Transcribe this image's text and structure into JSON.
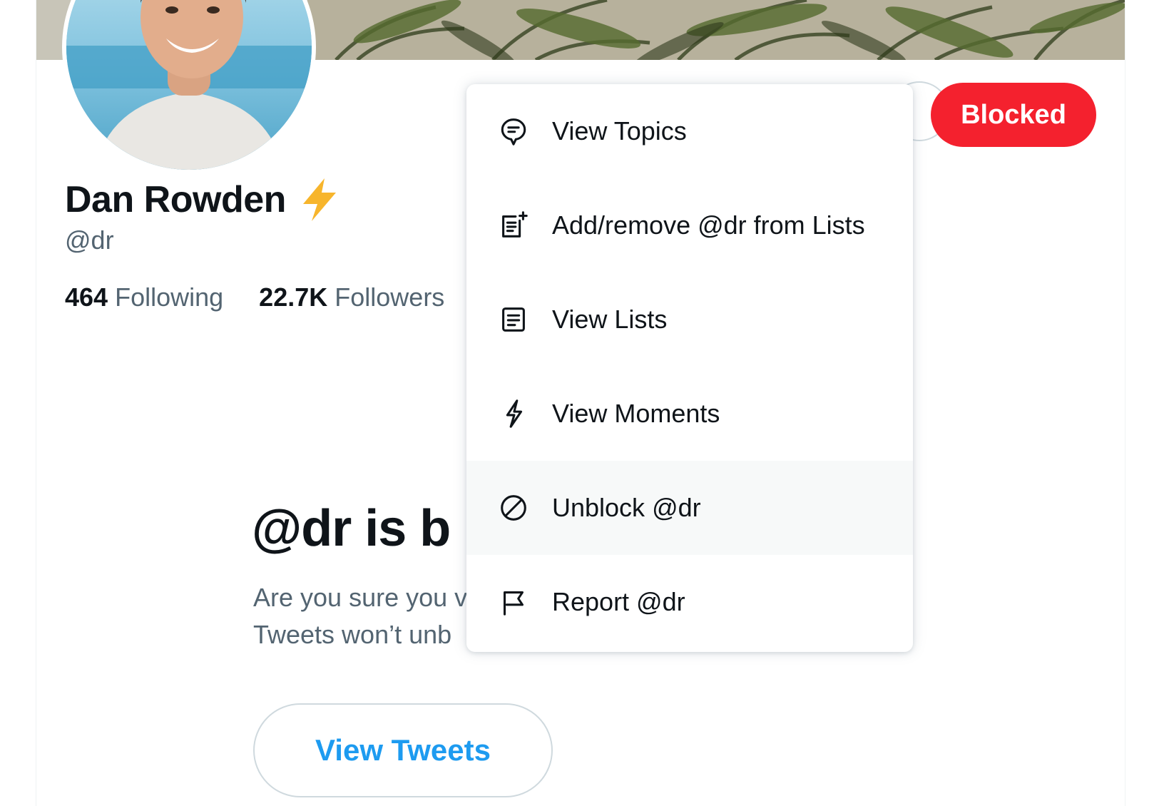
{
  "profile": {
    "display_name": "Dan Rowden",
    "handle": "@dr",
    "following_count": "464",
    "following_label": "Following",
    "followers_count": "22.7K",
    "followers_label": "Followers"
  },
  "blocked_notice": {
    "title": "@dr is b",
    "description_line1": "Are you sure you v",
    "description_line2": "Tweets won’t unb",
    "view_tweets_label": "View Tweets"
  },
  "header_actions": {
    "blocked_label": "Blocked",
    "blocked_color": "#f4212e"
  },
  "menu": {
    "items": [
      {
        "label": "View Topics",
        "icon": "topics-icon"
      },
      {
        "label": "Add/remove @dr from Lists",
        "icon": "list-add-icon"
      },
      {
        "label": "View Lists",
        "icon": "lists-icon"
      },
      {
        "label": "View Moments",
        "icon": "moments-icon"
      },
      {
        "label": "Unblock @dr",
        "icon": "unblock-icon",
        "hovered": true
      },
      {
        "label": "Report @dr",
        "icon": "report-flag-icon"
      }
    ]
  },
  "colors": {
    "accent": "#1d9bf0",
    "text_primary": "#0f1419",
    "text_secondary": "#536471",
    "hover_bg": "#f7f9f9"
  }
}
